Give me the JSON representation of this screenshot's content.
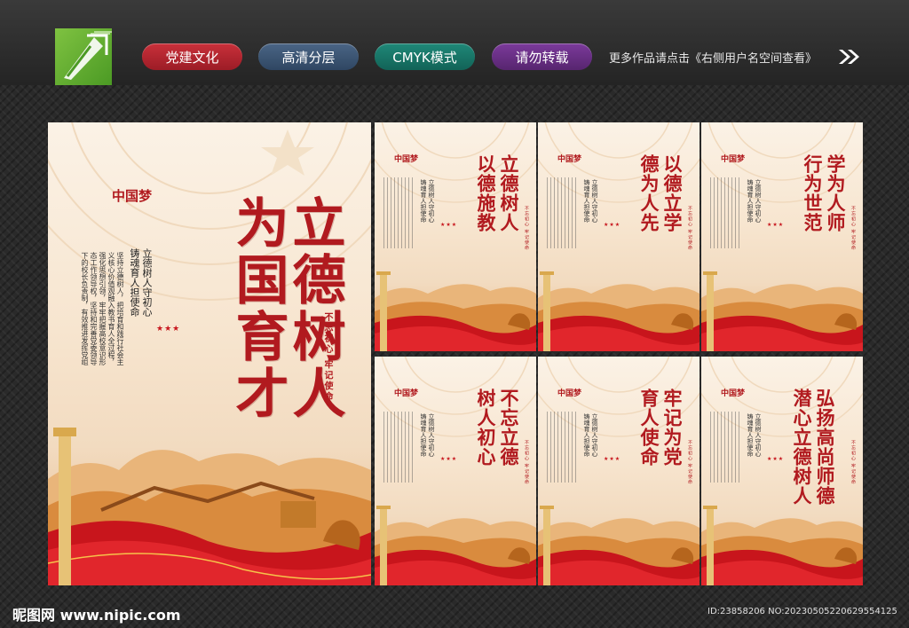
{
  "header": {
    "tags": [
      "党建文化",
      "高清分层",
      "CMYK模式",
      "请勿转载"
    ],
    "more_text": "更多作品请点击《右侧用户名空间查看》",
    "logo_icon": "pen-nib-icon",
    "arrow_icon": "double-chevron-right-icon"
  },
  "main_poster": {
    "title_lines": [
      "立德树人",
      "为国育才"
    ],
    "brand": "中国梦",
    "slogan_lines": [
      "立德树人守初心",
      "铸魂育人担使命"
    ],
    "sub_text": "不忘初心 牢记使命",
    "paragraph": "坚持立德树人，把培育和践行社会主义核心价值观融入教书育人全过程，强化思想引领，牢牢把握高校意识形态工作领导权，坚持和完善党委领导下的校长负责制，有效推进发挥党组织战斗堡垒作用和共产党员先锋模范作用"
  },
  "small_posters": [
    {
      "title": "立德树人以德施教",
      "lines": [
        "立德树人",
        "以德施教"
      ]
    },
    {
      "title": "以德立学德为人先",
      "lines": [
        "以德立学",
        "德为人先"
      ]
    },
    {
      "title": "学为人师行为世范",
      "lines": [
        "学为人师",
        "行为世范"
      ]
    },
    {
      "title": "不忘立德树人初心",
      "lines": [
        "不忘立德",
        "树人初心"
      ]
    },
    {
      "title": "牢记为党育人使命",
      "lines": [
        "牢记为党",
        "育人使命"
      ]
    },
    {
      "title": "弘扬高尚师德潜心立德树人",
      "lines": [
        "弘扬高尚师德",
        "潜心立德树人"
      ]
    }
  ],
  "small_common": {
    "brand": "中国梦",
    "slogan_lines": [
      "立德树人守初心",
      "铸魂育人担使命"
    ],
    "sub_text": "不忘初心 牢记使命"
  },
  "footer": {
    "site": "昵图网 www.nipic.com",
    "id_text": "ID:23858206 NO:20230505220629554125"
  },
  "colors": {
    "accent_red": "#b11a1f",
    "pill_red": "#c9303a",
    "pill_blue": "#4a6585",
    "pill_teal": "#1f8878",
    "pill_purple": "#7b3a9b",
    "logo_green": "#7fc241"
  }
}
